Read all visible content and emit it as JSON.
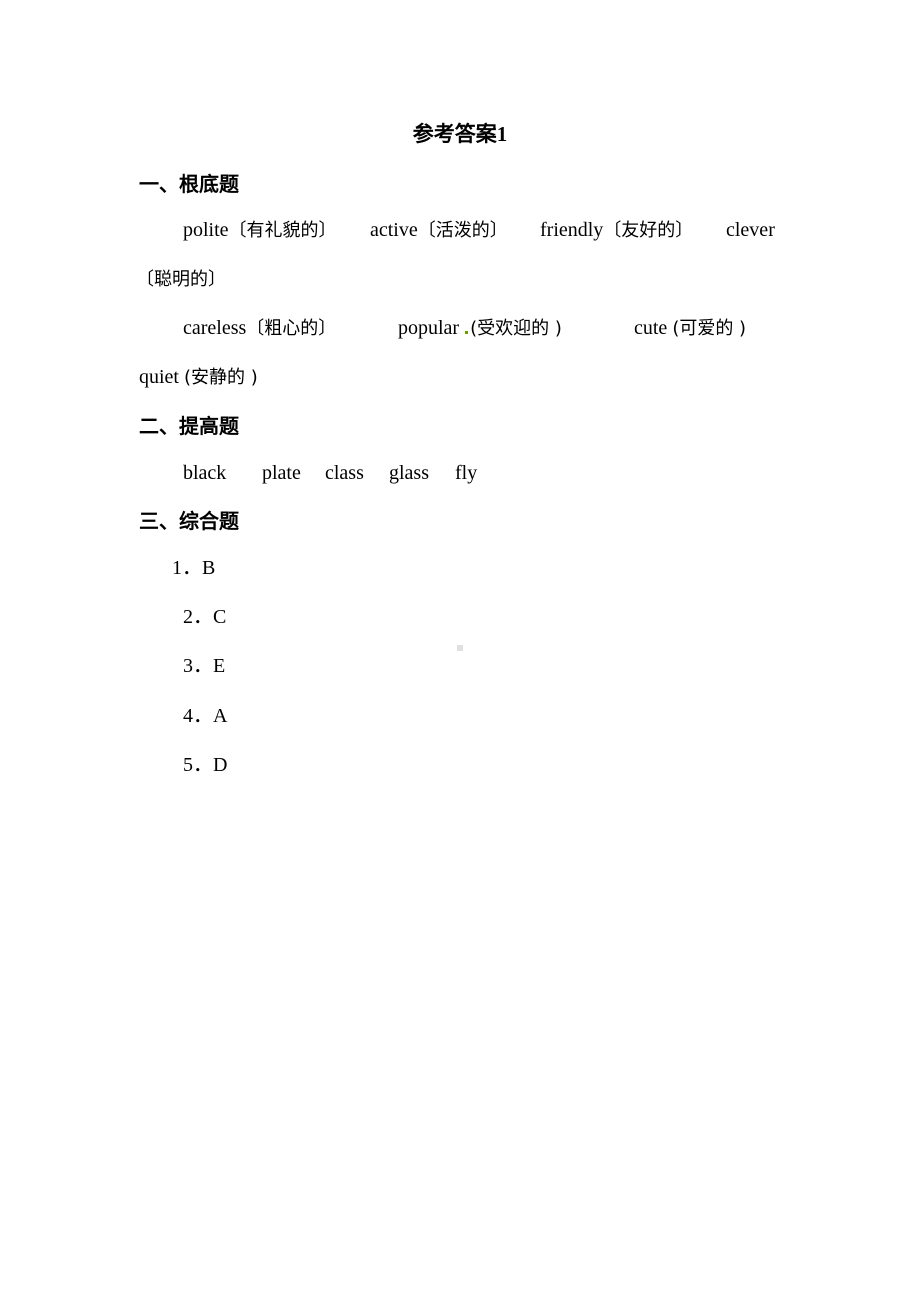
{
  "title": "参考答案1",
  "sections": [
    {
      "heading": "一、根底题",
      "lines": [
        {
          "items": [
            {
              "en": "polite",
              "cn": "〔有礼貌的〕"
            },
            {
              "en": "active",
              "cn": "〔活泼的〕"
            },
            {
              "en": "friendly",
              "cn": "〔友好的〕"
            },
            {
              "en": "clever",
              "cn": ""
            }
          ],
          "wrap": "〔聪明的〕"
        },
        {
          "items": [
            {
              "en": "careless",
              "cn": "〔粗心的〕"
            },
            {
              "en": "popular",
              "cn": "(受欢迎的 )"
            },
            {
              "en": "cute",
              "cn": "(可爱的 )"
            }
          ],
          "wrap_en": "quiet",
          "wrap_cn": "(安静的 )"
        }
      ]
    },
    {
      "heading": "二、提高题",
      "words": [
        "black",
        "plate",
        "class",
        "glass",
        "fly"
      ]
    },
    {
      "heading": "三、综合题",
      "answers": [
        {
          "num": "1．",
          "val": "B"
        },
        {
          "num": "2．",
          "val": "C"
        },
        {
          "num": "3．",
          "val": "E"
        },
        {
          "num": "4．",
          "val": "A"
        },
        {
          "num": "5．",
          "val": "D"
        }
      ]
    }
  ]
}
